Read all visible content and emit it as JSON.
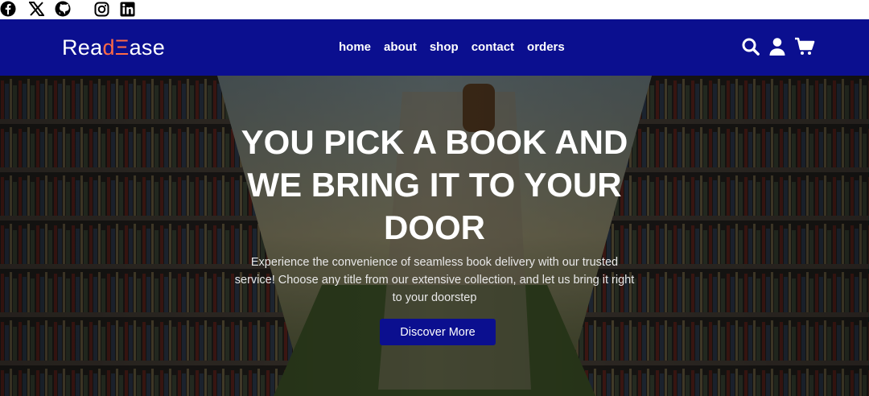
{
  "social": {
    "items": [
      {
        "name": "facebook-icon"
      },
      {
        "name": "x-icon"
      },
      {
        "name": "github-icon"
      },
      {
        "name": "instagram-icon"
      },
      {
        "name": "linkedin-icon"
      }
    ]
  },
  "header": {
    "logo": {
      "part1": "Rea",
      "part2": "dΞ",
      "part3": "ase"
    },
    "links": [
      "home",
      "about",
      "shop",
      "contact",
      "orders"
    ],
    "icons": [
      "search-icon",
      "user-icon",
      "cart-icon"
    ]
  },
  "hero": {
    "title_line1": "YOU PICK A BOOK AND",
    "title_line2": "WE BRING IT TO YOUR",
    "title_line3": "DOOR",
    "description": "Experience the convenience of seamless book delivery with our trusted service! Choose any title from our extensive collection, and let us bring it right to your doorstep",
    "button_label": "Discover More"
  },
  "colors": {
    "nav_bg": "#0b0f8f",
    "logo_accent": "#ff6a45",
    "button_bg": "#0b0f8f"
  }
}
